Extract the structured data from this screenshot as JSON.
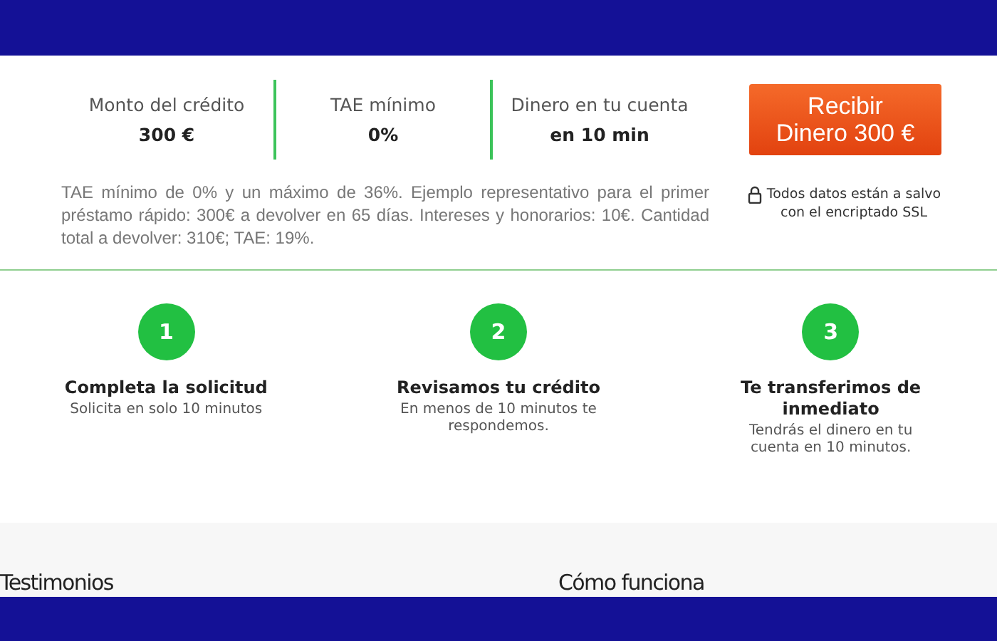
{
  "summary": {
    "stats": [
      {
        "label": "Monto del crédito",
        "value": "300 €"
      },
      {
        "label": "TAE mínimo",
        "value": "0%"
      },
      {
        "label": "Dinero en tu cuenta",
        "value": "en 10 min"
      }
    ],
    "button": "Recibir Dinero 300 €"
  },
  "disclaimer": "TAE mínimo de 0% y un máximo de 36%. Ejemplo representativo para el primer préstamo rápido: 300€ a devolver en 65 días. Intereses y honorarios: 10€. Cantidad total a devolver: 310€; TAE: 19%.",
  "security_note": "Todos datos están a salvo con el encriptado SSL",
  "steps": [
    {
      "number": "1",
      "title": "Completa la solicitud",
      "text": "Solicita en solo 10 minutos"
    },
    {
      "number": "2",
      "title": "Revisamos tu crédito",
      "text": "En menos de 10 minutos te respondemos."
    },
    {
      "number": "3",
      "title": "Te transferimos de inmediato",
      "text": "Tendrás el dinero en tu cuenta en 10 minutos."
    }
  ],
  "sections": [
    "Testimonios",
    "Cómo funciona"
  ]
}
